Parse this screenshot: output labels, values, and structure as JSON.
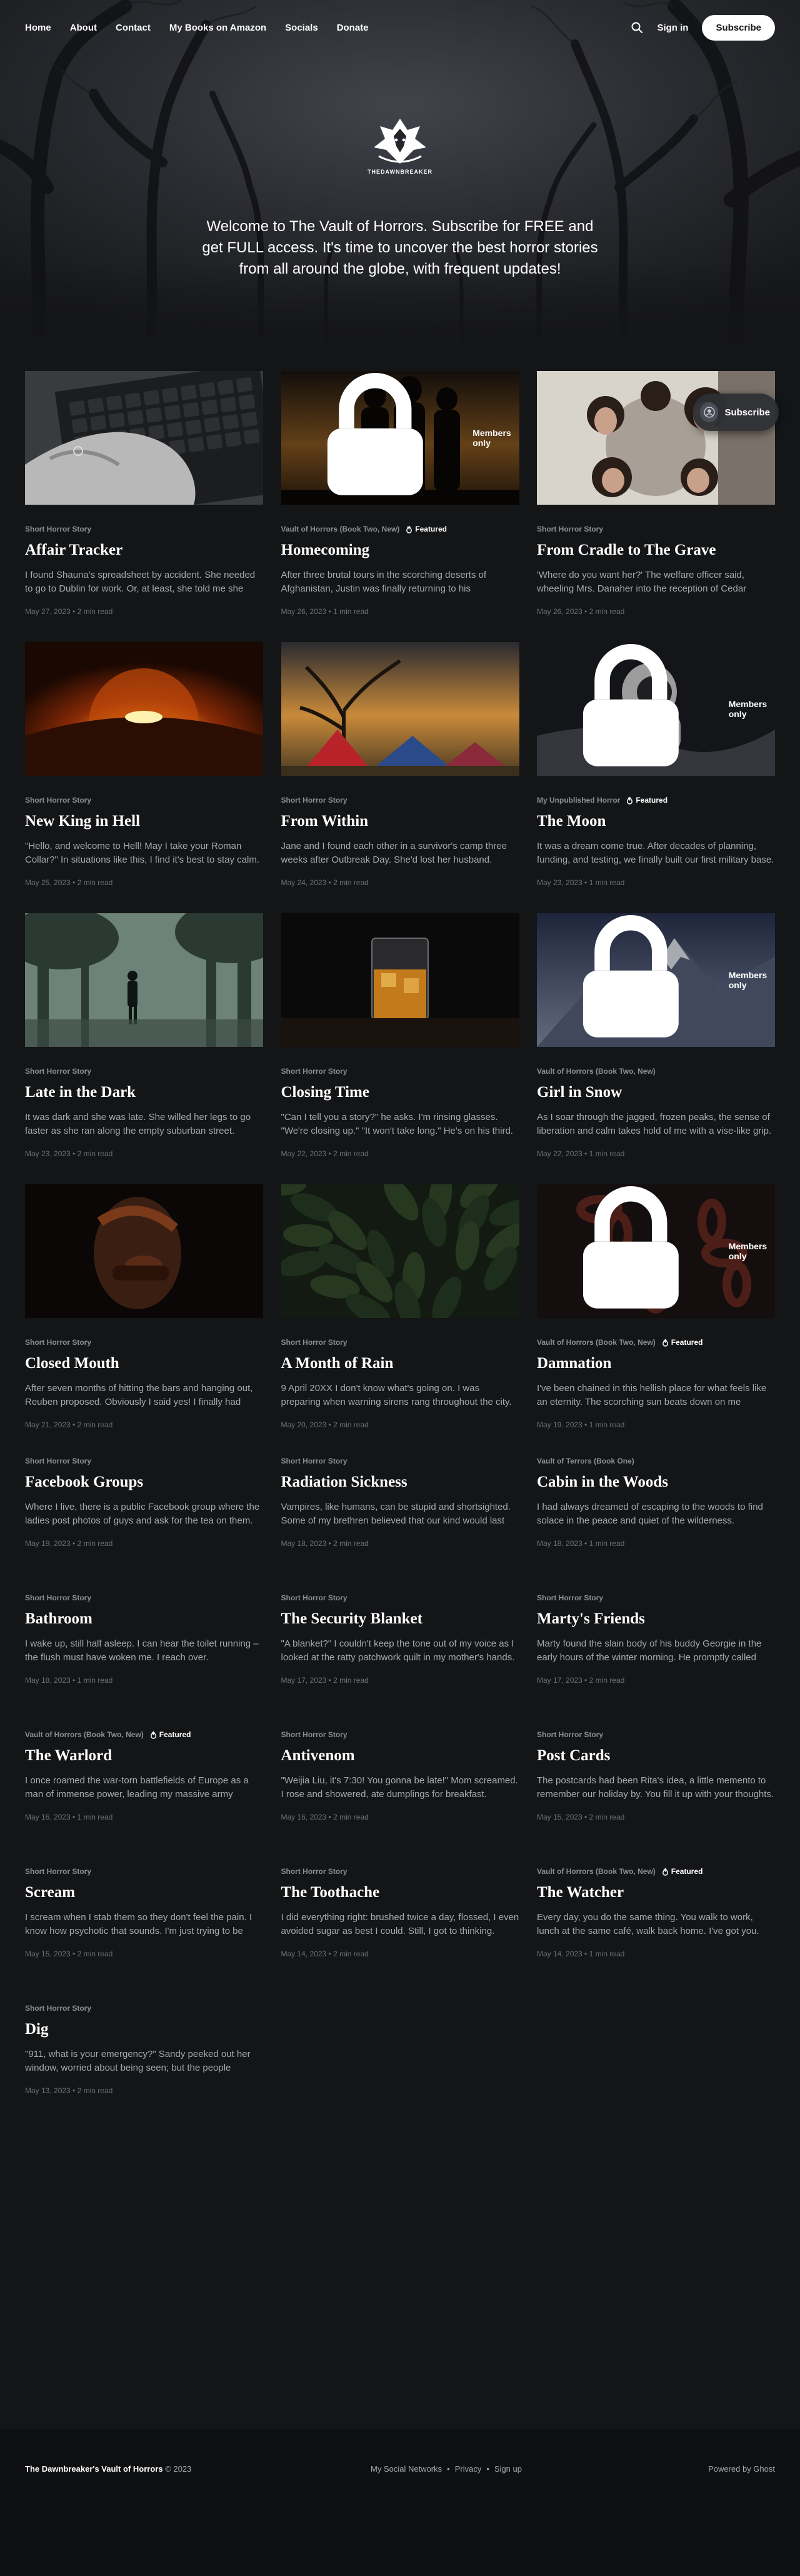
{
  "nav": {
    "links": [
      "Home",
      "About",
      "Contact",
      "My Books on Amazon",
      "Socials",
      "Donate"
    ],
    "signin": "Sign in",
    "subscribe": "Subscribe"
  },
  "brand": {
    "name": "THEDAWNBREAKER"
  },
  "hero": {
    "description": "Welcome to The Vault of Horrors. Subscribe for FREE and get FULL access. It's time to uncover the best horror stories from all around the globe, with frequent updates!"
  },
  "floating_subscribe": "Subscribe",
  "labels": {
    "members_only": "Members only",
    "featured": "Featured"
  },
  "posts": [
    {
      "tag": "Short Horror Story",
      "title": "Affair Tracker",
      "excerpt": "I found Shauna's spreadsheet by accident. She needed to go to Dublin for work. Or, at least, she told me she needed to go to Dublin for work.",
      "date": "May 27, 2023",
      "read": "2 min read",
      "featured": false,
      "members": false,
      "image": "hands-keyboard"
    },
    {
      "tag": "Vault of Horrors (Book Two, New)",
      "title": "Homecoming",
      "excerpt": "After three brutal tours in the scorching deserts of Afghanistan, Justin was finally returning to his hometown.",
      "date": "May 26, 2023",
      "read": "1 min read",
      "featured": true,
      "members": true,
      "image": "soldiers-sunset"
    },
    {
      "tag": "Short Horror Story",
      "title": "From Cradle to The Grave",
      "excerpt": "'Where do you want her?' The welfare officer said, wheeling Mrs. Danaher into the reception of Cedar Grove.",
      "date": "May 26, 2023",
      "read": "2 min read",
      "featured": false,
      "members": false,
      "image": "people-circle"
    },
    {
      "tag": "Short Horror Story",
      "title": "New King in Hell",
      "excerpt": "\"Hello, and welcome to Hell! May I take your Roman Collar?\" In situations like this, I find it's best to stay calm.",
      "date": "May 25, 2023",
      "read": "2 min read",
      "featured": false,
      "members": false,
      "image": "planet-fire"
    },
    {
      "tag": "Short Horror Story",
      "title": "From Within",
      "excerpt": "Jane and I found each other in a survivor's camp three weeks after Outbreak Day. She'd lost her husband.",
      "date": "May 24, 2023",
      "read": "2 min read",
      "featured": false,
      "members": false,
      "image": "camp-tents"
    },
    {
      "tag": "My Unpublished Horror",
      "title": "The Moon",
      "excerpt": "It was a dream come true. After decades of planning, funding, and testing, we finally built our first military base.",
      "date": "May 23, 2023",
      "read": "1 min read",
      "featured": true,
      "members": true,
      "image": "astronaut"
    },
    {
      "tag": "Short Horror Story",
      "title": "Late in the Dark",
      "excerpt": "It was dark and she was late. She willed her legs to go faster as she ran along the empty suburban street.",
      "date": "May 23, 2023",
      "read": "2 min read",
      "featured": false,
      "members": false,
      "image": "foggy-forest"
    },
    {
      "tag": "Short Horror Story",
      "title": "Closing Time",
      "excerpt": "\"Can I tell you a story?\" he asks. I'm rinsing glasses. \"We're closing up.\" \"It won't take long.\" He's on his third.",
      "date": "May 22, 2023",
      "read": "2 min read",
      "featured": false,
      "members": false,
      "image": "whiskey-glass"
    },
    {
      "tag": "Vault of Horrors (Book Two, New)",
      "title": "Girl in Snow",
      "excerpt": "As I soar through the jagged, frozen peaks, the sense of liberation and calm takes hold of me with a vise-like grip.",
      "date": "May 22, 2023",
      "read": "1 min read",
      "featured": false,
      "members": true,
      "image": "snow-mountain"
    },
    {
      "tag": "Short Horror Story",
      "title": "Closed Mouth",
      "excerpt": "After seven months of hitting the bars and hanging out, Reuben proposed. Obviously I said yes! I finally had everything.",
      "date": "May 21, 2023",
      "read": "2 min read",
      "featured": false,
      "members": false,
      "image": "dark-face"
    },
    {
      "tag": "Short Horror Story",
      "title": "A Month of Rain",
      "excerpt": "9 April 20XX I don't know what's going on. I was preparing when warning sirens rang throughout the city.",
      "date": "May 20, 2023",
      "read": "2 min read",
      "featured": false,
      "members": false,
      "image": "dark-leaves"
    },
    {
      "tag": "Vault of Horrors (Book Two, New)",
      "title": "Damnation",
      "excerpt": "I've been chained in this hellish place for what feels like an eternity. The scorching sun beats down on me mercilessly.",
      "date": "May 19, 2023",
      "read": "1 min read",
      "featured": true,
      "members": true,
      "image": "chains"
    },
    {
      "tag": "Short Horror Story",
      "title": "Facebook Groups",
      "excerpt": "Where I live, there is a public Facebook group where the ladies post photos of guys and ask for the tea on them.",
      "date": "May 19, 2023",
      "read": "2 min read",
      "featured": false,
      "members": false,
      "image": null
    },
    {
      "tag": "Short Horror Story",
      "title": "Radiation Sickness",
      "excerpt": "Vampires, like humans, can be stupid and shortsighted. Some of my brethren believed that our kind would last forever.",
      "date": "May 18, 2023",
      "read": "2 min read",
      "featured": false,
      "members": false,
      "image": null
    },
    {
      "tag": "Vault of Terrors (Book One)",
      "title": "Cabin in the Woods",
      "excerpt": "I had always dreamed of escaping to the woods to find solace in the peace and quiet of the wilderness.",
      "date": "May 18, 2023",
      "read": "1 min read",
      "featured": false,
      "members": false,
      "image": null
    },
    {
      "tag": "Short Horror Story",
      "title": "Bathroom",
      "excerpt": "I wake up, still half asleep. I can hear the toilet running – the flush must have woken me. I reach over.",
      "date": "May 18, 2023",
      "read": "1 min read",
      "featured": false,
      "members": false,
      "image": null
    },
    {
      "tag": "Short Horror Story",
      "title": "The Security Blanket",
      "excerpt": "\"A blanket?\" I couldn't keep the tone out of my voice as I looked at the ratty patchwork quilt in my mother's hands.",
      "date": "May 17, 2023",
      "read": "2 min read",
      "featured": false,
      "members": false,
      "image": null
    },
    {
      "tag": "Short Horror Story",
      "title": "Marty's Friends",
      "excerpt": "Marty found the slain body of his buddy Georgie in the early hours of the winter morning. He promptly called them.",
      "date": "May 17, 2023",
      "read": "2 min read",
      "featured": false,
      "members": false,
      "image": null
    },
    {
      "tag": "Vault of Horrors (Book Two, New)",
      "title": "The Warlord",
      "excerpt": "I once roamed the war-torn battlefields of Europe as a man of immense power, leading my massive army forward.",
      "date": "May 16, 2023",
      "read": "1 min read",
      "featured": true,
      "members": false,
      "image": null
    },
    {
      "tag": "Short Horror Story",
      "title": "Antivenom",
      "excerpt": "\"Weijia Liu, it's 7:30! You gonna be late!\" Mom screamed. I rose and showered, ate dumplings for breakfast.",
      "date": "May 16, 2023",
      "read": "2 min read",
      "featured": false,
      "members": false,
      "image": null
    },
    {
      "tag": "Short Horror Story",
      "title": "Post Cards",
      "excerpt": "The postcards had been Rita's idea, a little memento to remember our holiday by. You fill it up with your thoughts.",
      "date": "May 15, 2023",
      "read": "2 min read",
      "featured": false,
      "members": false,
      "image": null
    },
    {
      "tag": "Short Horror Story",
      "title": "Scream",
      "excerpt": "I scream when I stab them so they don't feel the pain. I know how psychotic that sounds. I'm just trying to be kind.",
      "date": "May 15, 2023",
      "read": "2 min read",
      "featured": false,
      "members": false,
      "image": null
    },
    {
      "tag": "Short Horror Story",
      "title": "The Toothache",
      "excerpt": "I did everything right: brushed twice a day, flossed, I even avoided sugar as best I could. Still, I got to thinking.",
      "date": "May 14, 2023",
      "read": "2 min read",
      "featured": false,
      "members": false,
      "image": null
    },
    {
      "tag": "Vault of Horrors (Book Two, New)",
      "title": "The Watcher",
      "excerpt": "Every day, you do the same thing. You walk to work, lunch at the same café, walk back home. I've got you.",
      "date": "May 14, 2023",
      "read": "1 min read",
      "featured": true,
      "members": false,
      "image": null
    },
    {
      "tag": "Short Horror Story",
      "title": "Dig",
      "excerpt": "\"911, what is your emergency?\" Sandy peeked out her window, worried about being seen; but the people outside saw her.",
      "date": "May 13, 2023",
      "read": "2 min read",
      "featured": false,
      "members": false,
      "image": null
    }
  ],
  "footer": {
    "site_name": "The Dawnbreaker's Vault of Horrors",
    "year": "© 2023",
    "links": [
      "My Social Networks",
      "Privacy",
      "Sign up"
    ],
    "separator": "•",
    "powered": "Powered by Ghost"
  }
}
